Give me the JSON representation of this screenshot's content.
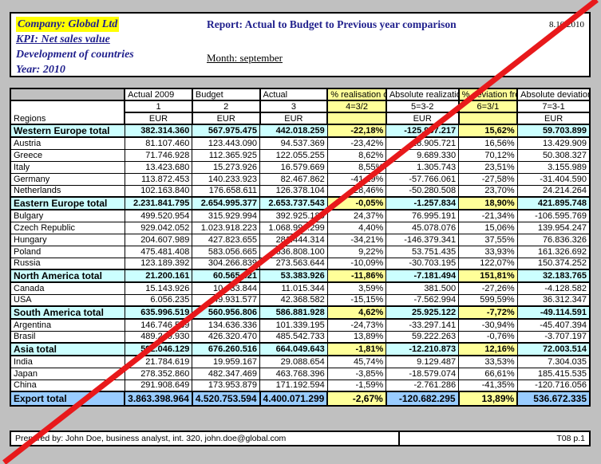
{
  "header": {
    "company": "Company: Global Ltd",
    "kpi": "KPI: Net sales value",
    "development": "Development of countries",
    "year": "Year: 2010",
    "title": "Report: Actual to Budget to Previous year comparison",
    "date": "8.10.2010",
    "month": "Month: september"
  },
  "table": {
    "regions_label": "Regions",
    "columns": [
      {
        "title": "Actual 2009",
        "number": "1",
        "currency": "EUR",
        "highlight": false
      },
      {
        "title": "Budget",
        "number": "2",
        "currency": "EUR",
        "highlight": false
      },
      {
        "title": "Actual",
        "number": "3",
        "currency": "EUR",
        "highlight": false
      },
      {
        "title": "% realisation of budget",
        "number": "4=3/2",
        "currency": "",
        "highlight": true
      },
      {
        "title": "Absolute realization of budget",
        "number": "5=3-2",
        "currency": "EUR",
        "highlight": false
      },
      {
        "title": "% deviation from previous year",
        "number": "6=3/1",
        "currency": "",
        "highlight": true
      },
      {
        "title": "Absolute deviation from previous year",
        "number": "7=3-1",
        "currency": "EUR",
        "highlight": false
      }
    ],
    "rows": [
      {
        "type": "total",
        "name": "Western Europe total",
        "values": [
          "382.314.360",
          "567.975.475",
          "442.018.259",
          "-22,18%",
          "-125.957.217",
          "15,62%",
          "59.703.899"
        ]
      },
      {
        "type": "item",
        "name": "Austria",
        "values": [
          "81.107.460",
          "123.443.090",
          "94.537.369",
          "-23,42%",
          "-28.905.721",
          "16,56%",
          "13.429.909"
        ]
      },
      {
        "type": "item",
        "name": "Greece",
        "values": [
          "71.746.928",
          "112.365.925",
          "122.055.255",
          "8,62%",
          "9.689.330",
          "70,12%",
          "50.308.327"
        ]
      },
      {
        "type": "item",
        "name": "Italy",
        "values": [
          "13.423.680",
          "15.273.926",
          "16.579.669",
          "8,55%",
          "1.305.743",
          "23,51%",
          "3.155.989"
        ]
      },
      {
        "type": "item",
        "name": "Germany",
        "values": [
          "113.872.453",
          "140.233.923",
          "82.467.862",
          "-41,19%",
          "-57.766.061",
          "-27,58%",
          "-31.404.590"
        ]
      },
      {
        "type": "item",
        "name": "Netherlands",
        "values": [
          "102.163.840",
          "176.658.611",
          "126.378.104",
          "-28,46%",
          "-50.280.508",
          "23,70%",
          "24.214.264"
        ]
      },
      {
        "type": "total",
        "name": "Eastern Europe total",
        "values": [
          "2.231.841.795",
          "2.654.995.377",
          "2.653.737.543",
          "-0,05%",
          "-1.257.834",
          "18,90%",
          "421.895.748"
        ]
      },
      {
        "type": "item",
        "name": "Bulgary",
        "values": [
          "499.520.954",
          "315.929.994",
          "392.925.185",
          "24,37%",
          "76.995.191",
          "-21,34%",
          "-106.595.769"
        ]
      },
      {
        "type": "item",
        "name": "Czech Republic",
        "values": [
          "929.042.052",
          "1.023.918.223",
          "1.068.996.299",
          "4,40%",
          "45.078.076",
          "15,06%",
          "139.954.247"
        ]
      },
      {
        "type": "item",
        "name": "Hungary",
        "values": [
          "204.607.989",
          "427.823.655",
          "281.444.314",
          "-34,21%",
          "-146.379.341",
          "37,55%",
          "76.836.326"
        ]
      },
      {
        "type": "item",
        "name": "Poland",
        "values": [
          "475.481.408",
          "583.056.665",
          "636.808.100",
          "9,22%",
          "53.751.435",
          "33,93%",
          "161.326.692"
        ]
      },
      {
        "type": "item",
        "name": "Russia",
        "values": [
          "123.189.392",
          "304.266.839",
          "273.563.644",
          "-10,09%",
          "-30.703.195",
          "122,07%",
          "150.374.252"
        ]
      },
      {
        "type": "total",
        "name": "North America total",
        "values": [
          "21.200.161",
          "60.565.421",
          "53.383.926",
          "-11,86%",
          "-7.181.494",
          "151,81%",
          "32.183.765"
        ]
      },
      {
        "type": "item",
        "name": "Canada",
        "values": [
          "15.143.926",
          "10.633.844",
          "11.015.344",
          "3,59%",
          "381.500",
          "-27,26%",
          "-4.128.582"
        ]
      },
      {
        "type": "item",
        "name": "USA",
        "values": [
          "6.056.235",
          "49.931.577",
          "42.368.582",
          "-15,15%",
          "-7.562.994",
          "599,59%",
          "36.312.347"
        ]
      },
      {
        "type": "total",
        "name": "South America total",
        "values": [
          "635.996.519",
          "560.956.806",
          "586.881.928",
          "4,62%",
          "25.925.122",
          "-7,72%",
          "-49.114.591"
        ]
      },
      {
        "type": "item",
        "name": "Argentina",
        "values": [
          "146.746.589",
          "134.636.336",
          "101.339.195",
          "-24,73%",
          "-33.297.141",
          "-30,94%",
          "-45.407.394"
        ]
      },
      {
        "type": "item",
        "name": "Brasil",
        "values": [
          "489.249.930",
          "426.320.470",
          "485.542.733",
          "13,89%",
          "59.222.263",
          "-0,76%",
          "-3.707.197"
        ]
      },
      {
        "type": "total",
        "name": "Asia total",
        "values": [
          "592.046.129",
          "676.260.516",
          "664.049.643",
          "-1,81%",
          "-12.210.873",
          "12,16%",
          "72.003.514"
        ]
      },
      {
        "type": "item",
        "name": "India",
        "values": [
          "21.784.619",
          "19.959.167",
          "29.088.654",
          "45,74%",
          "9.129.487",
          "33,53%",
          "7.304.035"
        ]
      },
      {
        "type": "item",
        "name": "Japan",
        "values": [
          "278.352.860",
          "482.347.469",
          "463.768.396",
          "-3,85%",
          "-18.579.074",
          "66,61%",
          "185.415.535"
        ]
      },
      {
        "type": "item",
        "name": "China",
        "values": [
          "291.908.649",
          "173.953.879",
          "171.192.594",
          "-1,59%",
          "-2.761.286",
          "-41,35%",
          "-120.716.056"
        ]
      },
      {
        "type": "export",
        "name": "Export total",
        "values": [
          "3.863.398.964",
          "4.520.753.594",
          "4.400.071.299",
          "-2,67%",
          "-120.682.295",
          "13,89%",
          "536.672.335"
        ]
      }
    ]
  },
  "footer": {
    "prepared_by": "Prepared by: John Doe, business analyst, int. 320, john.doe@global.com",
    "page_ref": "T08  p.1"
  },
  "colors": {
    "accent_text": "#1f1f8c",
    "highlight_yellow": "#ffff99",
    "company_highlight": "#ffff00",
    "total_row": "#ccffff",
    "export_row": "#99ccff",
    "annotation_red": "#e8191b",
    "page_background": "#c0c0c0"
  },
  "annotation": {
    "name": "diagonal-strike-line"
  }
}
